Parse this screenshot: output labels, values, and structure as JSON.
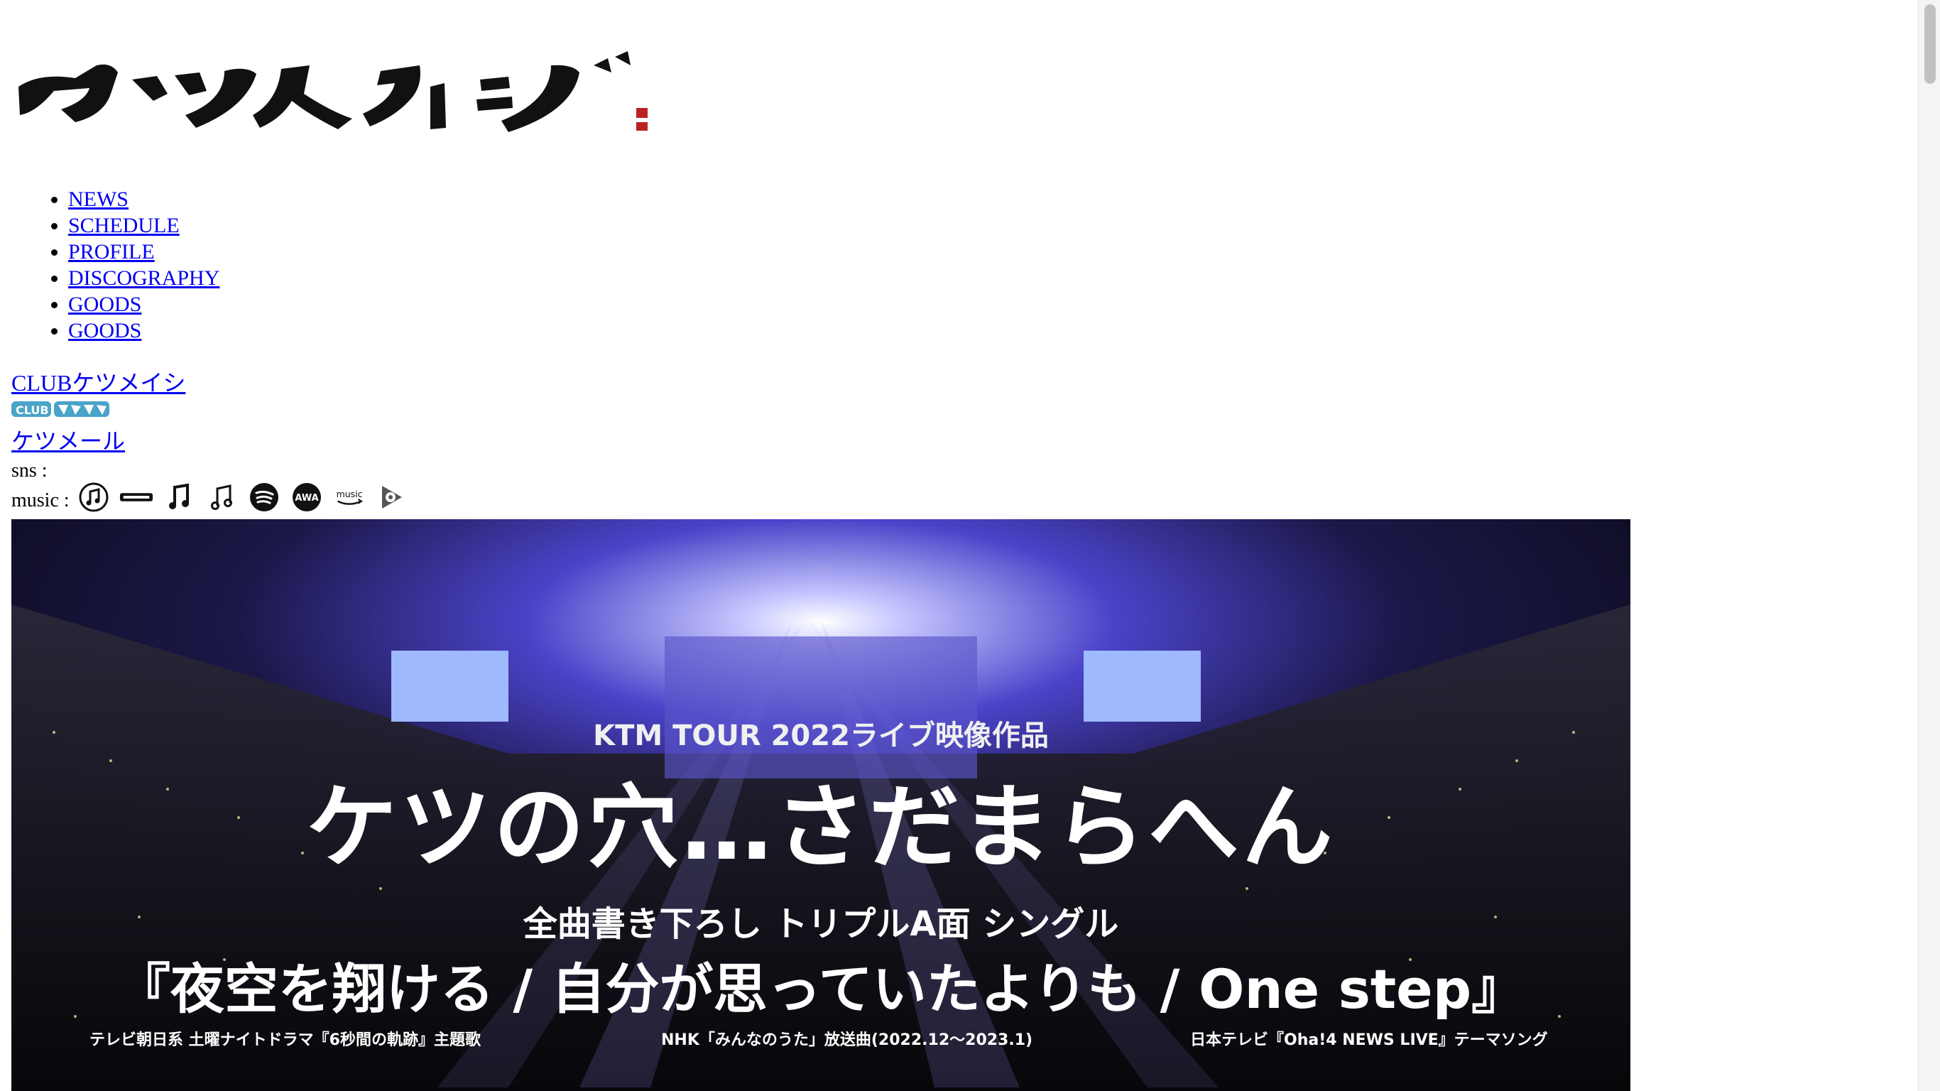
{
  "site": {
    "logo_alt": "ケツメイシ",
    "logo_text": "ケツメイシ"
  },
  "nav": {
    "items": [
      {
        "label": "NEWS"
      },
      {
        "label": "SCHEDULE"
      },
      {
        "label": "PROFILE"
      },
      {
        "label": "DISCOGRAPHY"
      },
      {
        "label": "GOODS"
      },
      {
        "label": "GOODS"
      }
    ]
  },
  "links": {
    "club": "CLUBケツメイシ",
    "club_logo_text": "CLUB ケツメイシ",
    "mail": "ケツメール"
  },
  "social": {
    "sns_label": "sns :",
    "music_label": "music :",
    "music_icons": [
      {
        "name": "itunes-icon"
      },
      {
        "name": "recochoku-icon"
      },
      {
        "name": "music-note-icon"
      },
      {
        "name": "double-note-icon"
      },
      {
        "name": "spotify-icon"
      },
      {
        "name": "awa-icon"
      },
      {
        "name": "amazon-music-icon"
      },
      {
        "name": "google-play-music-icon"
      }
    ]
  },
  "hero": {
    "tour": "KTM TOUR 2022ライブ映像作品",
    "title": "ケツの穴…さだまらへん",
    "subtitle": "全曲書き下ろし トリプルA面 シングル",
    "single": "『夜空を翔ける / 自分が思っていたよりも / One step』",
    "note_1": "テレビ朝日系 土曜ナイトドラマ『6秒間の軌跡』主題歌",
    "note_2": "NHK「みんなのうた」放送曲(2022.12～2023.1)",
    "note_3": "日本テレビ『Oha!4 NEWS LIVE』テーマソング"
  },
  "colors": {
    "link": "#0000ee",
    "background": "#ffffff",
    "hero_stage_light": "#6d6dff"
  }
}
